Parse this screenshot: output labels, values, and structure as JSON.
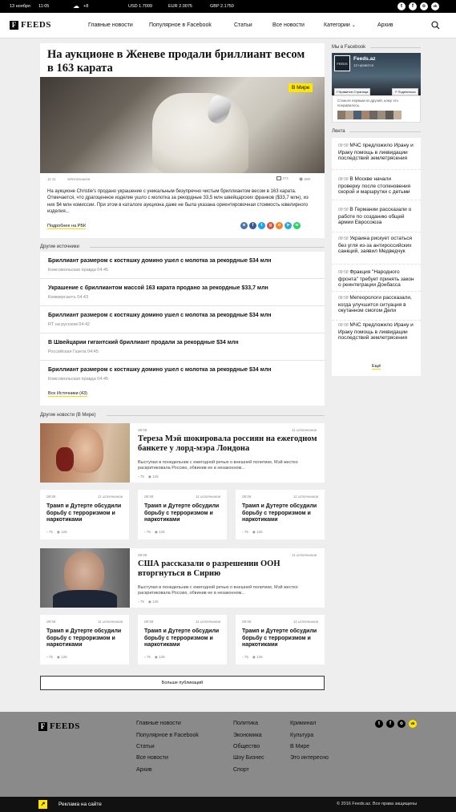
{
  "topbar": {
    "date": "13 ноября",
    "time": "11:05",
    "weather": "+8",
    "usd": "USD 1.7009",
    "eur": "EUR 2.0075",
    "gbp": "GBP 2.1750",
    "social": [
      "twitter-icon",
      "facebook-icon",
      "odnoklassniki-icon",
      "vk-icon"
    ]
  },
  "nav": {
    "logo_mark": "F",
    "logo_text": "FEEDS",
    "items": [
      "Главные новости",
      "Популярное в Facebook",
      "Статьи",
      "Все новости",
      "Категории",
      "Архив"
    ]
  },
  "article": {
    "title": "На аукционе в Женеве продали бриллиант весом в 163 карата",
    "badge": "В Мире",
    "time": "11:11",
    "sources": "4Источников",
    "comments": "374",
    "views": "598",
    "body": "На аукционе Christie's продано украшение с уникальным безупречно чистым бриллиантом весом в 163 карата. Отмечается, что драгоценное изделие ушло с молотка за рекордные 33,5 млн швейцарских франков ($33,7 млн), из них $4 млн комиссии. При этом в каталоге аукциона даже не была указана ориентировочная стоимость ювелирного изделия...",
    "more_link": "Подробнее на РБК",
    "share_colors": [
      "#4a76a8",
      "#3b5998",
      "#1da1f2",
      "#dc4e41",
      "#f58220",
      "#2ca5e0",
      "#25d366"
    ]
  },
  "other_sources": {
    "title": "Другие источники",
    "items": [
      {
        "title": "Бриллиант размером с костяшку домино ушел с молотка за рекордные $34 млн",
        "source": "Комсомольская правда 04:45"
      },
      {
        "title": "Украшение с бриллиантом массой 163 карата продано за рекордные $33,7 млн",
        "source": "Коммерсантъ 04:43"
      },
      {
        "title": "Бриллиант размером с костяшку домино ушел с молотка за рекордные $34 млн",
        "source": "RT на русском 04:42"
      },
      {
        "title": "В Швейцарии гигантский бриллиант продали за рекордные $34 млн",
        "source": "Российская Газета 04:45"
      },
      {
        "title": "Бриллиант размером с костяшку домино ушел с молотка за рекордные $34 млн",
        "source": "Комсомольская правда 04:45"
      }
    ],
    "all_link": "Все Источники (43)"
  },
  "other_news": {
    "title": "Другие новости (В Мире)",
    "big": [
      {
        "time": "08:58",
        "sources": "11 источников",
        "title": "Тереза Мэй шокировала россиян на ежегодном банкете у лорд-мэра Лондона",
        "desc": "Выступая в понедельник с ежегодной речью о внешней политике, Мэй жестко раскритиковала Россию, обвинив ее в незаконном...",
        "comments": "75",
        "views": "126"
      },
      {
        "time": "08:58",
        "sources": "11 источников",
        "title": "США рассказали о разрешении ООН вторгнуться в Сирию",
        "desc": "Выступая в понедельник с ежегодной речью о внешней политике, Мэй жестко раскритиковала Россию, обвинив ее в незаконном...",
        "comments": "75",
        "views": "126"
      }
    ],
    "small": {
      "time": "08:58",
      "sources": "11 источников",
      "title": "Трамп и Дутерте обсудили борьбу с терроризмом и наркотиками",
      "comments": "75",
      "views": "126"
    },
    "more_button": "Больше публикаций"
  },
  "sidebar": {
    "fb_title": "Мы в Facebook",
    "fb_page": "Feeds.az",
    "fb_likes": "13 нравится",
    "fb_like_btn": "Нравится Страница",
    "fb_share_btn": "Поделиться",
    "fb_friends": "Станьте первым из друзей, кому это понравилось.",
    "lenta_title": "Лента",
    "lenta": [
      {
        "time": "08:58",
        "text": "МЧС предложило Ирану и Ираку помощь в ликвидации последствий землетрясения"
      },
      {
        "time": "08:58",
        "text": "В Москве начали проверку после столкновения скорой и маршрутки с детьми"
      },
      {
        "time": "08:58",
        "text": "В Германии рассказали о работе по созданию общей армии Евросоюза"
      },
      {
        "time": "08:58",
        "text": "Украина рискует остаться без угля из-за антироссийских санкций, заявил Медведчук"
      },
      {
        "time": "08:58",
        "text": "Фракция \"Народного фронта\" требует принять закон о реинтеграции Донбасса"
      },
      {
        "time": "08:58",
        "text": "Метеорологи рассказали, когда улучшится ситуация в окутанном смогом Дели"
      },
      {
        "time": "08:58",
        "text": "МЧС предложило Ирану и Ираку помощь в ликвидации последствий землетрясения"
      }
    ],
    "more": "Ещё"
  },
  "footer": {
    "col1": [
      "Главные новости",
      "Популярное в Facebook",
      "Статьи",
      "Все новости",
      "Архив"
    ],
    "col2": [
      "Политика",
      "Экономика",
      "Общество",
      "Шоу Бизнес",
      "Спорт"
    ],
    "col3": [
      "Криминал",
      "Культура",
      "В Мире",
      "Это интересно"
    ],
    "ads": "Реклама на сайте",
    "copyright": "© 2016 Feeds.az. Все права защищены"
  },
  "colors": {
    "accent_yellow": "#ffe600",
    "black": "#000000",
    "link_underline": "#ffd800"
  }
}
